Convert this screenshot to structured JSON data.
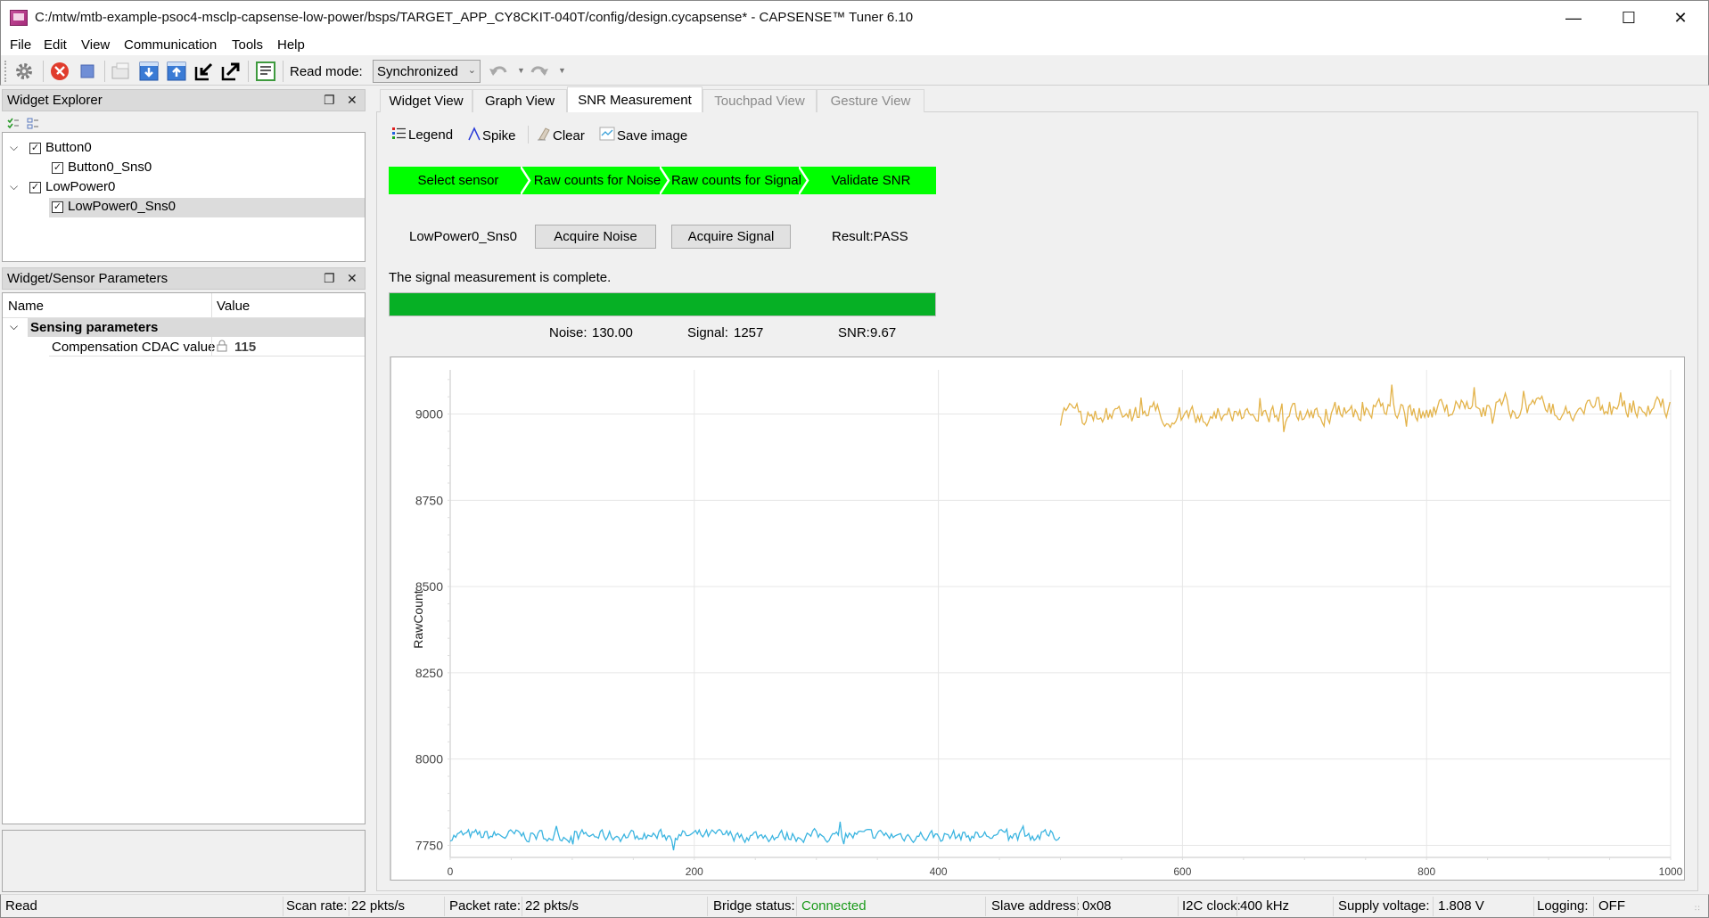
{
  "window": {
    "title": "C:/mtw/mtb-example-psoc4-msclp-capsense-low-power/bsps/TARGET_APP_CY8CKIT-040T/config/design.cycapsense* - CAPSENSE™ Tuner 6.10",
    "minimize": "—",
    "maximize": "☐",
    "close": "✕"
  },
  "menu": [
    "File",
    "Edit",
    "View",
    "Communication",
    "Tools",
    "Help"
  ],
  "toolbar": {
    "icons": [
      "gear-icon",
      "disconnect-icon",
      "stop-icon",
      "open-folder-icon",
      "import-icon",
      "export-icon",
      "read-from-device-icon",
      "write-to-device-icon",
      "log-icon",
      "undo-icon",
      "redo-icon"
    ],
    "read_mode_label": "Read mode:",
    "read_mode_value": "Synchronized"
  },
  "widget_explorer": {
    "title": "Widget Explorer",
    "tree": [
      {
        "label": "Button0",
        "level": 0,
        "checked": true,
        "expanded": true
      },
      {
        "label": "Button0_Sns0",
        "level": 1,
        "checked": true
      },
      {
        "label": "LowPower0",
        "level": 0,
        "checked": true,
        "expanded": true
      },
      {
        "label": "LowPower0_Sns0",
        "level": 1,
        "checked": true,
        "selected": true
      }
    ]
  },
  "params": {
    "title": "Widget/Sensor Parameters",
    "columns": [
      "Name",
      "Value"
    ],
    "group": "Sensing parameters",
    "rows": [
      {
        "name": "Compensation CDAC value",
        "value": "115",
        "locked": true
      }
    ]
  },
  "tabs": [
    {
      "label": "Widget View",
      "state": "normal"
    },
    {
      "label": "Graph View",
      "state": "normal"
    },
    {
      "label": "SNR Measurement",
      "state": "active"
    },
    {
      "label": "Touchpad View",
      "state": "disabled"
    },
    {
      "label": "Gesture View",
      "state": "disabled"
    }
  ],
  "snr": {
    "tools": {
      "legend": "Legend",
      "spike": "Spike",
      "clear": "Clear",
      "save_image": "Save image"
    },
    "steps": [
      "Select sensor",
      "Raw counts for Noise",
      "Raw counts for Signal",
      "Validate SNR"
    ],
    "step_color": "#00ff00",
    "sensor": "LowPower0_Sns0",
    "acquire_noise": "Acquire Noise",
    "acquire_signal": "Acquire Signal",
    "result": "Result:PASS",
    "status_message": "The signal measurement is complete.",
    "progress_percent": 100,
    "progress_color": "#06b025",
    "noise_label": "Noise:",
    "noise_value": "130.00",
    "signal_label": "Signal:",
    "signal_value": "1257",
    "snr_label": "SNR:",
    "snr_value": "9.67"
  },
  "chart_data": {
    "type": "line",
    "title": "",
    "xlabel": "",
    "ylabel": "RawCount",
    "xlim": [
      0,
      1000
    ],
    "ylim": [
      7715,
      9128
    ],
    "x_ticks": [
      0,
      200,
      400,
      600,
      800,
      1000
    ],
    "y_ticks": [
      7750,
      8000,
      8250,
      8500,
      8750,
      9000
    ],
    "grid": true,
    "series": [
      {
        "name": "Noise",
        "color": "#3ab4e0",
        "x_range": [
          0,
          500
        ],
        "mean": 7778,
        "amplitude": 28,
        "seed": 7
      },
      {
        "name": "Signal",
        "color": "#e3b34a",
        "x_range": [
          500,
          1000
        ],
        "mean": 9008,
        "amplitude": 48,
        "trend": 30,
        "seed": 13
      }
    ]
  },
  "statusbar": {
    "state": "Read",
    "scan_rate_label": "Scan rate:",
    "scan_rate": "22 pkts/s",
    "packet_rate_label": "Packet rate:",
    "packet_rate": "22 pkts/s",
    "bridge_label": "Bridge status:",
    "bridge_status": "Connected",
    "bridge_color": "#1a9a1a",
    "slave_label": "Slave address:",
    "slave_address": "0x08",
    "i2c_label": "I2C clock:",
    "i2c_clock": "400 kHz",
    "supply_label": "Supply voltage:",
    "supply_voltage": "1.808 V",
    "logging_label": "Logging:",
    "logging": "OFF"
  }
}
